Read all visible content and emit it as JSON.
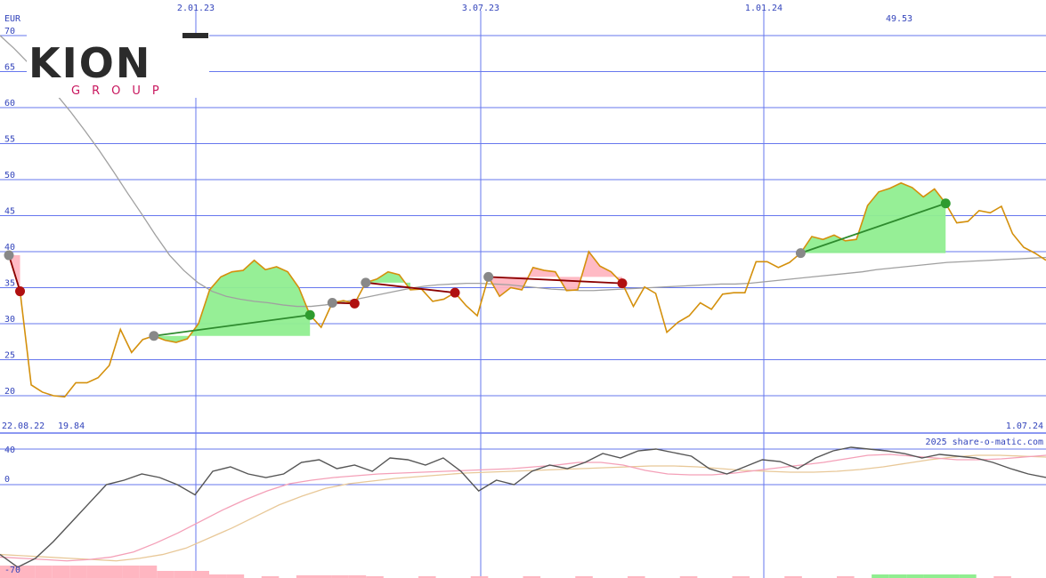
{
  "chart_data": [
    {
      "type": "line",
      "currency": "EUR",
      "ylim": [
        15,
        70
      ],
      "y_ticks": [
        "70",
        "65",
        "60",
        "55",
        "50",
        "45",
        "40",
        "35",
        "30",
        "25",
        "20"
      ],
      "x_labels_top": [
        "2.01.23",
        "3.07.23",
        "1.01.24"
      ],
      "start_date_label": "22.08.22",
      "end_date_label": "1.07.24",
      "max_label": "49.53",
      "min_label": "19.84",
      "colors": {
        "price": "#d4900c",
        "ma_long": "#a0a0a0",
        "grid": "#6677ee",
        "up_fill": "#90ee90",
        "down_fill": "#ffb6c1",
        "up_line": "#2e8b2e",
        "down_line": "#8b0000"
      },
      "series": [
        {
          "values": [
            39.5,
            34.5,
            21.5,
            20.5,
            20.0,
            19.84,
            21.8,
            21.8,
            22.5,
            24.2,
            29.2,
            26.0,
            27.8,
            28.3,
            27.7,
            27.4,
            27.9,
            30.0,
            34.7,
            36.5,
            37.2,
            37.4,
            38.8,
            37.5,
            37.9,
            37.2,
            35.0,
            31.2,
            29.5,
            32.9,
            33.2,
            32.8,
            35.7,
            36.2,
            37.2,
            36.8,
            34.7,
            34.8,
            33.1,
            33.4,
            34.3,
            32.5,
            31.1,
            36.5,
            33.8,
            35.0,
            34.7,
            37.8,
            37.4,
            37.2,
            34.6,
            34.7,
            40.0,
            38.0,
            37.2,
            35.6,
            32.4,
            35.1,
            34.2,
            28.8,
            30.2,
            31.1,
            32.9,
            32.0,
            34.1,
            34.3,
            34.3,
            38.6,
            38.6,
            37.8,
            38.5,
            39.8,
            42.1,
            41.7,
            42.3,
            41.5,
            41.7,
            46.4,
            48.3,
            48.8,
            49.53,
            48.9,
            47.6,
            48.7,
            46.7,
            44.0,
            44.2,
            45.7,
            45.4,
            46.3,
            42.5,
            40.6,
            39.8,
            38.8
          ]
        },
        {
          "values": [
            70.0,
            68.2,
            66.2,
            64.1,
            61.8,
            59.4,
            56.8,
            54.1,
            51.2,
            48.2,
            45.3,
            42.3,
            39.5,
            37.4,
            35.7,
            34.5,
            33.8,
            33.4,
            33.1,
            32.9,
            32.6,
            32.4,
            32.4,
            32.6,
            32.9,
            33.3,
            33.7,
            34.1,
            34.5,
            34.9,
            35.2,
            35.4,
            35.5,
            35.6,
            35.6,
            35.5,
            35.4,
            35.2,
            35.0,
            34.8,
            34.7,
            34.6,
            34.6,
            34.7,
            34.8,
            34.9,
            35.0,
            35.1,
            35.2,
            35.3,
            35.4,
            35.5,
            35.5,
            35.6,
            35.8,
            36.0,
            36.2,
            36.4,
            36.6,
            36.8,
            37.0,
            37.2,
            37.5,
            37.7,
            37.9,
            38.1,
            38.3,
            38.5,
            38.6,
            38.7,
            38.8,
            38.9,
            39.0,
            39.1,
            39.2
          ]
        }
      ],
      "trend_segments": [
        {
          "kind": "down",
          "x0": "22.08.22",
          "y0": 39.5,
          "x1": "",
          "y1": 34.5
        },
        {
          "kind": "up",
          "y0": 28.3,
          "y1": 31.1
        },
        {
          "kind": "down",
          "y0": 33.0,
          "y1": 32.8
        },
        {
          "kind": "down",
          "y0": 35.7,
          "y1": 31.9
        },
        {
          "kind": "down",
          "y0": 36.5,
          "y1": 35.6
        },
        {
          "kind": "up",
          "y0": 39.8,
          "y1": 46.7
        }
      ]
    },
    {
      "type": "line",
      "ylim": [
        -70,
        45
      ],
      "y_ticks": [
        "40",
        "0",
        "-70"
      ],
      "watermark": "2025 share-o-matic.com",
      "colors": {
        "momentum": "#555555",
        "signal_fast": "#f4a0b8",
        "signal_slow": "#e8c898",
        "bar_neg": "#ffb6c1",
        "bar_pos": "#90ee90"
      },
      "series": [
        {
          "values": [
            -55,
            -65,
            -58,
            -45,
            -30,
            -15,
            0,
            5,
            12,
            8,
            0,
            -8,
            15,
            20,
            12,
            8,
            12,
            25,
            28,
            18,
            22,
            15,
            30,
            28,
            22,
            30,
            15,
            -5,
            5,
            0,
            15,
            22,
            18,
            25,
            35,
            30,
            38,
            40,
            36,
            32,
            18,
            12,
            20,
            28,
            26,
            18,
            30,
            38,
            42,
            40,
            38,
            35,
            30,
            34,
            32,
            30,
            25,
            18,
            12,
            8
          ]
        },
        {
          "values": [
            -57,
            -58,
            -59,
            -60,
            -59,
            -57,
            -53,
            -46,
            -38,
            -29,
            -20,
            -12,
            -5,
            1,
            5,
            8,
            10,
            12,
            13,
            14,
            15,
            16,
            17,
            18,
            20,
            22,
            25,
            25,
            22,
            16,
            12,
            11,
            11,
            13,
            16,
            19,
            22,
            25,
            29,
            33,
            34,
            32,
            30,
            28,
            28,
            29,
            31,
            33
          ]
        },
        {
          "values": [
            -55,
            -56,
            -57,
            -58,
            -59,
            -60,
            -58,
            -55,
            -50,
            -42,
            -34,
            -25,
            -16,
            -9,
            -3,
            1,
            4,
            7,
            9,
            11,
            13,
            14,
            15,
            16,
            17,
            18,
            19,
            20,
            21,
            21,
            20,
            18,
            16,
            15,
            14,
            14,
            15,
            17,
            20,
            24,
            28,
            31,
            33,
            33,
            32,
            31
          ]
        }
      ]
    }
  ],
  "logo": {
    "main": "KION",
    "sub": "GROUP"
  }
}
